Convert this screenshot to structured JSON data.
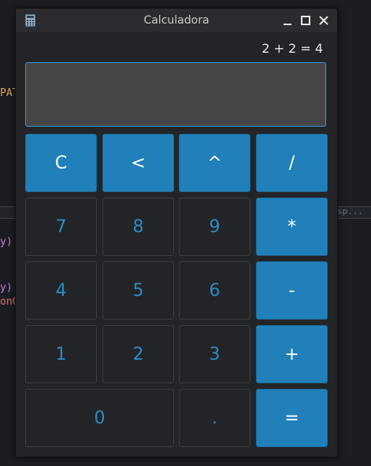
{
  "window": {
    "title": "Calculadora"
  },
  "history": "2 + 2 = 4",
  "display_value": "",
  "background": {
    "frag_pat": "PAT",
    "frag_y1": "y)",
    "frag_y2": "y)",
    "frag_ong": "onG",
    "frag_sp": "sp..."
  },
  "keys": {
    "clear": "C",
    "back": "<",
    "pow": "^",
    "div": "/",
    "seven": "7",
    "eight": "8",
    "nine": "9",
    "mul": "*",
    "four": "4",
    "five": "5",
    "six": "6",
    "sub": "-",
    "one": "1",
    "two": "2",
    "three": "3",
    "add": "+",
    "zero": "0",
    "dot": ".",
    "eq": "="
  },
  "colors": {
    "accent": "#2180b9",
    "number_text": "#2b8bc4",
    "display": "#444546"
  }
}
